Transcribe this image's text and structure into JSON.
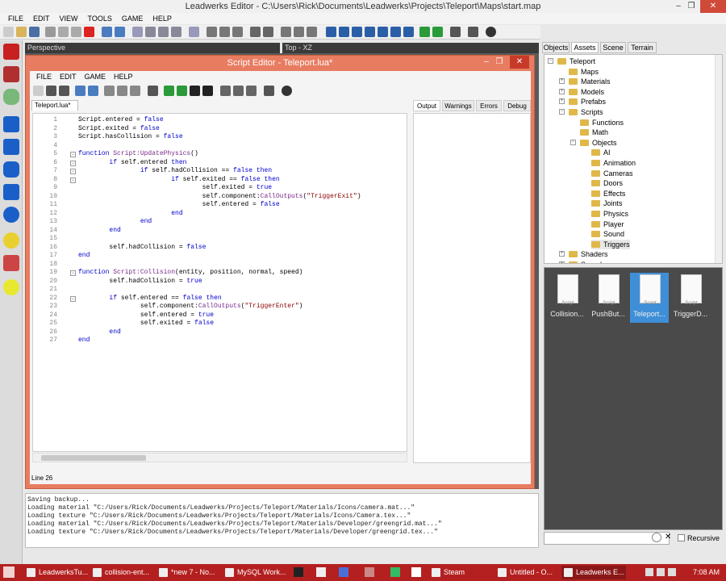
{
  "window": {
    "title": "Leadwerks Editor - C:\\Users\\Rick\\Documents\\Leadwerks\\Projects\\Teleport\\Maps\\start.map"
  },
  "menu": [
    "FILE",
    "EDIT",
    "VIEW",
    "TOOLS",
    "GAME",
    "HELP"
  ],
  "viewports": {
    "left_label": "Perspective",
    "right_label": "Top - XZ"
  },
  "script_editor": {
    "title": "Script Editor - Teleport.lua*",
    "menu": [
      "FILE",
      "EDIT",
      "GAME",
      "HELP"
    ],
    "file_tab": "Teleport.lua*",
    "output_tabs": [
      "Output",
      "Warnings",
      "Errors",
      "Debug"
    ],
    "status": "Line 26",
    "code": [
      {
        "n": "1",
        "t": "Script.entered = false"
      },
      {
        "n": "2",
        "t": "Script.exited = false"
      },
      {
        "n": "3",
        "t": "Script.hasCollision = false"
      },
      {
        "n": "4",
        "t": ""
      },
      {
        "n": "5",
        "t": "function Script:UpdatePhysics()"
      },
      {
        "n": "6",
        "t": "        if self.entered then"
      },
      {
        "n": "7",
        "t": "                if self.hadCollision == false then"
      },
      {
        "n": "8",
        "t": "                        if self.exited == false then"
      },
      {
        "n": "9",
        "t": "                                self.exited = true"
      },
      {
        "n": "10",
        "t": "                                self.component:CallOutputs(\"TriggerExit\")"
      },
      {
        "n": "11",
        "t": "                                self.entered = false"
      },
      {
        "n": "12",
        "t": "                        end"
      },
      {
        "n": "13",
        "t": "                end"
      },
      {
        "n": "14",
        "t": "        end"
      },
      {
        "n": "15",
        "t": ""
      },
      {
        "n": "16",
        "t": "        self.hadCollision = false"
      },
      {
        "n": "17",
        "t": "end"
      },
      {
        "n": "18",
        "t": ""
      },
      {
        "n": "19",
        "t": "function Script:Collision(entity, position, normal, speed)"
      },
      {
        "n": "20",
        "t": "        self.hadCollision = true"
      },
      {
        "n": "21",
        "t": ""
      },
      {
        "n": "22",
        "t": "        if self.entered == false then"
      },
      {
        "n": "23",
        "t": "                self.component:CallOutputs(\"TriggerEnter\")"
      },
      {
        "n": "24",
        "t": "                self.entered = true"
      },
      {
        "n": "25",
        "t": "                self.exited = false"
      },
      {
        "n": "26",
        "t": "        end"
      },
      {
        "n": "27",
        "t": "end"
      }
    ]
  },
  "console": [
    "Saving backup...",
    "Loading material \"C:/Users/Rick/Documents/Leadwerks/Projects/Teleport/Materials/Icons/camera.mat...\"",
    "Loading texture \"C:/Users/Rick/Documents/Leadwerks/Projects/Teleport/Materials/Icons/Camera.tex...\"",
    "Loading material \"C:/Users/Rick/Documents/Leadwerks/Projects/Teleport/Materials/Developer/greengrid.mat...\"",
    "Loading texture \"C:/Users/Rick/Documents/Leadwerks/Projects/Teleport/Materials/Developer/greengrid.tex...\""
  ],
  "right_panel": {
    "tabs": [
      "Objects",
      "Assets",
      "Scene",
      "Terrain"
    ],
    "tree": [
      {
        "label": "Teleport",
        "depth": 0,
        "exp": "-"
      },
      {
        "label": "Maps",
        "depth": 1,
        "exp": ""
      },
      {
        "label": "Materials",
        "depth": 1,
        "exp": "+"
      },
      {
        "label": "Models",
        "depth": 1,
        "exp": "+"
      },
      {
        "label": "Prefabs",
        "depth": 1,
        "exp": "+"
      },
      {
        "label": "Scripts",
        "depth": 1,
        "exp": "-"
      },
      {
        "label": "Functions",
        "depth": 2,
        "exp": ""
      },
      {
        "label": "Math",
        "depth": 2,
        "exp": ""
      },
      {
        "label": "Objects",
        "depth": 2,
        "exp": "-"
      },
      {
        "label": "AI",
        "depth": 3,
        "exp": ""
      },
      {
        "label": "Animation",
        "depth": 3,
        "exp": ""
      },
      {
        "label": "Cameras",
        "depth": 3,
        "exp": ""
      },
      {
        "label": "Doors",
        "depth": 3,
        "exp": ""
      },
      {
        "label": "Effects",
        "depth": 3,
        "exp": ""
      },
      {
        "label": "Joints",
        "depth": 3,
        "exp": ""
      },
      {
        "label": "Physics",
        "depth": 3,
        "exp": ""
      },
      {
        "label": "Player",
        "depth": 3,
        "exp": ""
      },
      {
        "label": "Sound",
        "depth": 3,
        "exp": ""
      },
      {
        "label": "Triggers",
        "depth": 3,
        "exp": ""
      },
      {
        "label": "Shaders",
        "depth": 1,
        "exp": "+"
      },
      {
        "label": "Sound",
        "depth": 1,
        "exp": "+"
      }
    ],
    "assets": [
      {
        "name": "Collision...",
        "type": "Script"
      },
      {
        "name": "PushBut...",
        "type": "Script"
      },
      {
        "name": "Teleport...",
        "type": "Script"
      },
      {
        "name": "TriggerD...",
        "type": "Script"
      }
    ],
    "recursive_label": "Recursive"
  },
  "taskbar": {
    "items": [
      "LeadwerksTu...",
      "collision-ent...",
      "*new 7 - No...",
      "MySQL Work...",
      "Steam",
      "Untitled - O...",
      "Leadwerks E..."
    ],
    "time": "7:08 AM"
  },
  "colors": {
    "editor_frame": "#e87c61",
    "taskbar": "#b42020",
    "selected_asset": "#3f8fd8"
  }
}
